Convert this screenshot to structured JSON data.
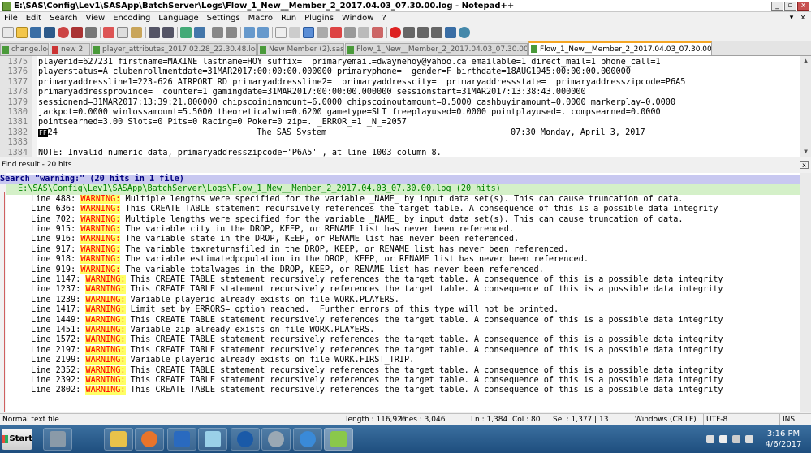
{
  "window": {
    "title": "E:\\SAS\\Config\\Lev1\\SASApp\\BatchServer\\Logs\\Flow_1_New__Member_2_2017.04.03_07.30.00.log - Notepad++",
    "buttons": {
      "minimize": "_",
      "restore": "▫",
      "close": "x"
    }
  },
  "menu": [
    "File",
    "Edit",
    "Search",
    "View",
    "Encoding",
    "Language",
    "Settings",
    "Macro",
    "Run",
    "Plugins",
    "Window",
    "?"
  ],
  "menu_mdi": {
    "minimize": "▾",
    "restore": "x"
  },
  "tabs": [
    {
      "label": "change.log",
      "active": false
    },
    {
      "label": "new 2",
      "active": false
    },
    {
      "label": "player_attributes_2017.02.28_22.30.48.log",
      "active": false
    },
    {
      "label": "New Member (2).sas",
      "active": false
    },
    {
      "label": "Flow_1_New__Member_2_2017.04.03_07.30.00.log",
      "active": false
    },
    {
      "label": "Flow_1_New__Member_2_2017.04.03_07.30.00.log",
      "active": true
    }
  ],
  "editor": {
    "lines": [
      {
        "num": "1375",
        "text": "playerid=627231 firstname=MAXINE lastname=HOY suffix=  primaryemail=dwaynehoy@yahoo.ca emailable=1 direct_mail=1 phone_call=1"
      },
      {
        "num": "1376",
        "text": "playerstatus=A clubenrollmentdate=31MAR2017:00:00:00.000000 primaryphone=  gender=F birthdate=18AUG1945:00:00:00.000000"
      },
      {
        "num": "1377",
        "text": "primaryaddressline1=223-626 AIRPORT RD primaryaddressline2=  primaryaddresscity=  primaryaddressstate=  primaryaddresszipcode=P6A5"
      },
      {
        "num": "1378",
        "text": "primaryaddressprovince=  counter=1 gamingdate=31MAR2017:00:00:00.000000 sessionstart=31MAR2017:13:38:43.000000"
      },
      {
        "num": "1379",
        "text": "sessionend=31MAR2017:13:39:21.000000 chipscoininamount=6.0000 chipscoinoutamount=0.5000 cashbuyinamount=0.0000 markerplay=0.0000"
      },
      {
        "num": "1380",
        "text": "jackpot=0.0000 winlossamount=5.5000 theoreticalwin=0.6200 gametype=SLT freeplayused=0.0000 pointplayused=. compsearned=0.0000"
      },
      {
        "num": "1381",
        "text": "pointsearned=3.00 Slots=0 Pits=0 Racing=0 Poker=0 zip=. _ERROR_=1 _N_=2057"
      },
      {
        "num": "1382",
        "text": "24                                        The SAS System                                     07:30 Monday, April 3, 2017",
        "ff": "FF"
      },
      {
        "num": "1383",
        "text": ""
      },
      {
        "num": "1384",
        "text": "NOTE: Invalid numeric data, primaryaddresszipcode='P6A5' , at line 1003 column 8."
      }
    ]
  },
  "find_panel": {
    "header": "Find result - 20 hits",
    "close": "x",
    "search_line": "Search \"warning:\" (20 hits in 1 file)",
    "file_line": "E:\\SAS\\Config\\Lev1\\SASApp\\BatchServer\\Logs\\Flow_1_New__Member_2_2017.04.03_07.30.00.log (20 hits)",
    "warning_label": "WARNING:",
    "hits": [
      {
        "prefix": "Line 488: ",
        "rest": " Multiple lengths were specified for the variable _NAME_ by input data set(s). This can cause truncation of data."
      },
      {
        "prefix": "Line 636: ",
        "rest": " This CREATE TABLE statement recursively references the target table. A consequence of this is a possible data integrity"
      },
      {
        "prefix": "Line 702: ",
        "rest": " Multiple lengths were specified for the variable _NAME_ by input data set(s). This can cause truncation of data."
      },
      {
        "prefix": "Line 915: ",
        "rest": " The variable city in the DROP, KEEP, or RENAME list has never been referenced."
      },
      {
        "prefix": "Line 916: ",
        "rest": " The variable state in the DROP, KEEP, or RENAME list has never been referenced."
      },
      {
        "prefix": "Line 917: ",
        "rest": " The variable taxreturnsfiled in the DROP, KEEP, or RENAME list has never been referenced."
      },
      {
        "prefix": "Line 918: ",
        "rest": " The variable estimatedpopulation in the DROP, KEEP, or RENAME list has never been referenced."
      },
      {
        "prefix": "Line 919: ",
        "rest": " The variable totalwages in the DROP, KEEP, or RENAME list has never been referenced."
      },
      {
        "prefix": "Line 1147: ",
        "rest": " This CREATE TABLE statement recursively references the target table. A consequence of this is a possible data integrity"
      },
      {
        "prefix": "Line 1237: ",
        "rest": " This CREATE TABLE statement recursively references the target table. A consequence of this is a possible data integrity"
      },
      {
        "prefix": "Line 1239: ",
        "rest": " Variable playerid already exists on file WORK.PLAYERS."
      },
      {
        "prefix": "Line 1417: ",
        "rest": " Limit set by ERRORS= option reached.  Further errors of this type will not be printed."
      },
      {
        "prefix": "Line 1449: ",
        "rest": " This CREATE TABLE statement recursively references the target table. A consequence of this is a possible data integrity"
      },
      {
        "prefix": "Line 1451: ",
        "rest": " Variable zip already exists on file WORK.PLAYERS."
      },
      {
        "prefix": "Line 1572: ",
        "rest": " This CREATE TABLE statement recursively references the target table. A consequence of this is a possible data integrity"
      },
      {
        "prefix": "Line 2197: ",
        "rest": " This CREATE TABLE statement recursively references the target table. A consequence of this is a possible data integrity"
      },
      {
        "prefix": "Line 2199: ",
        "rest": " Variable playerid already exists on file WORK.FIRST_TRIP."
      },
      {
        "prefix": "Line 2352: ",
        "rest": " This CREATE TABLE statement recursively references the target table. A consequence of this is a possible data integrity"
      },
      {
        "prefix": "Line 2392: ",
        "rest": " This CREATE TABLE statement recursively references the target table. A consequence of this is a possible data integrity"
      },
      {
        "prefix": "Line 2802: ",
        "rest": " This CREATE TABLE statement recursively references the target table. A consequence of this is a possible data integrity"
      }
    ]
  },
  "status": {
    "filetype": "Normal text file",
    "length": "length : 116,926",
    "lines": "lines : 3,046",
    "ln": "Ln : 1,384",
    "col": "Col : 80",
    "sel": "Sel : 1,377 | 13",
    "eol": "Windows (CR LF)",
    "encoding": "UTF-8",
    "mode": "INS"
  },
  "taskbar": {
    "start": "Start",
    "apps": [
      "server-manager",
      "file-explorer",
      "firefox",
      "sas-enterprise-guide",
      "notepad",
      "sas",
      "settings",
      "internet-explorer",
      "notepad-plus-plus"
    ],
    "time": "3:16 PM",
    "date": "4/6/2017"
  },
  "colors": {
    "warning_fg": "#ff0000",
    "warning_bg": "#ffff64",
    "search_line_bg": "#c8c8f0",
    "file_line_bg": "#d4f0c8",
    "active_tab_accent": "#f5a623"
  }
}
